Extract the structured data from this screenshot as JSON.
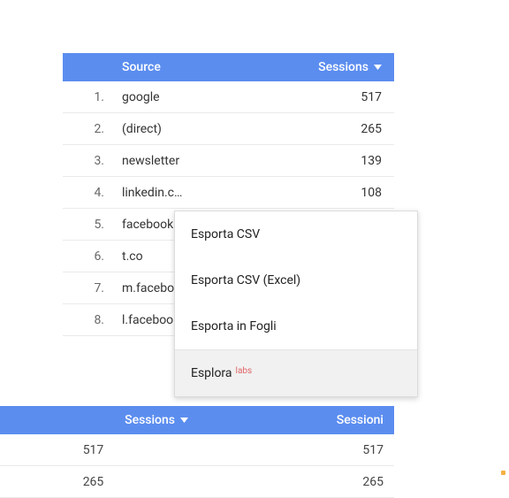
{
  "table1": {
    "headers": {
      "source": "Source",
      "sessions": "Sessions"
    },
    "rows": [
      {
        "n": "1.",
        "source": "google",
        "sessions": "517"
      },
      {
        "n": "2.",
        "source": "(direct)",
        "sessions": "265"
      },
      {
        "n": "3.",
        "source": "newsletter",
        "sessions": "139"
      },
      {
        "n": "4.",
        "source": "linkedin.c…",
        "sessions": "108"
      },
      {
        "n": "5.",
        "source": "facebook",
        "sessions": ""
      },
      {
        "n": "6.",
        "source": "t.co",
        "sessions": ""
      },
      {
        "n": "7.",
        "source": "m.facebo",
        "sessions": ""
      },
      {
        "n": "8.",
        "source": "l.facebool",
        "sessions": ""
      }
    ]
  },
  "menu": {
    "items": [
      "Esporta CSV",
      "Esporta CSV (Excel)",
      "Esporta in Fogli"
    ],
    "explore": "Esplora",
    "labs": "labs"
  },
  "table2": {
    "headers": {
      "sessions1": "Sessions",
      "sessions2": "Sessioni"
    },
    "rows": [
      {
        "a": "517",
        "b": "517"
      },
      {
        "a": "265",
        "b": "265"
      }
    ]
  },
  "chart_data": {
    "type": "table",
    "title": "",
    "columns": [
      "Source",
      "Sessions"
    ],
    "rows": [
      [
        "google",
        517
      ],
      [
        "(direct)",
        265
      ],
      [
        "newsletter",
        139
      ],
      [
        "linkedin.com",
        108
      ]
    ]
  }
}
